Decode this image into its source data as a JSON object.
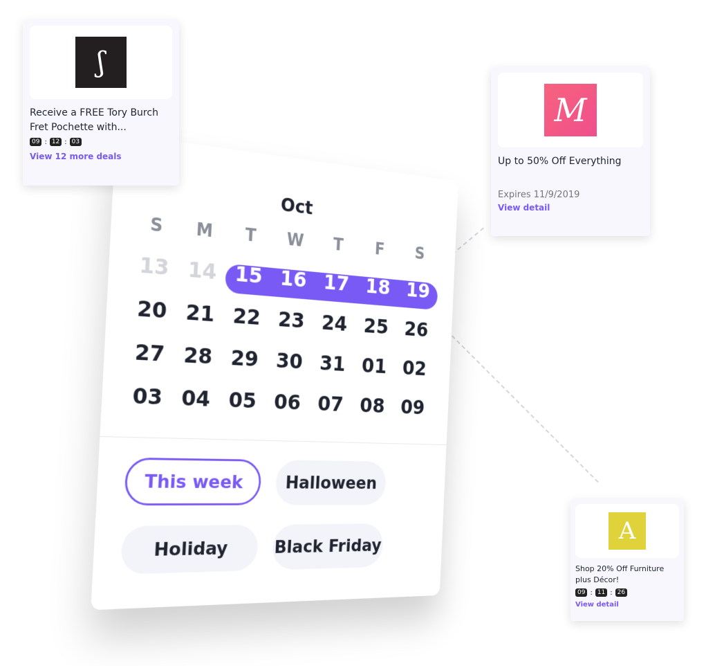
{
  "calendar": {
    "month": "Oct",
    "weekdays": [
      "S",
      "M",
      "T",
      "W",
      "T",
      "F",
      "S"
    ],
    "weeks": [
      [
        "13",
        "14",
        "15",
        "16",
        "17",
        "18",
        "19"
      ],
      [
        "20",
        "21",
        "22",
        "23",
        "24",
        "25",
        "26"
      ],
      [
        "27",
        "28",
        "29",
        "30",
        "31",
        "01",
        "02"
      ],
      [
        "03",
        "04",
        "05",
        "06",
        "07",
        "08",
        "09"
      ]
    ],
    "selected_range": [
      "15",
      "19"
    ],
    "accent": "#7a5af5"
  },
  "filters": [
    {
      "label": "This week",
      "active": true
    },
    {
      "label": "Halloween"
    },
    {
      "label": "Holiday"
    },
    {
      "label": "Black Friday"
    }
  ],
  "deals": [
    {
      "title": "Receive a FREE Tory Burch Fret Pochette with...",
      "timer": [
        "09",
        "12",
        "03"
      ],
      "link": "View 12 more deals",
      "logo": "S"
    },
    {
      "title": "Up to 50% Off Everything",
      "expires": "Expires 11/9/2019",
      "link": "View detail",
      "logo": "M"
    },
    {
      "title": "Shop 20% Off Furniture plus Décor!",
      "timer": [
        "09",
        "11",
        "26"
      ],
      "link": "View detail",
      "logo": "A"
    }
  ]
}
